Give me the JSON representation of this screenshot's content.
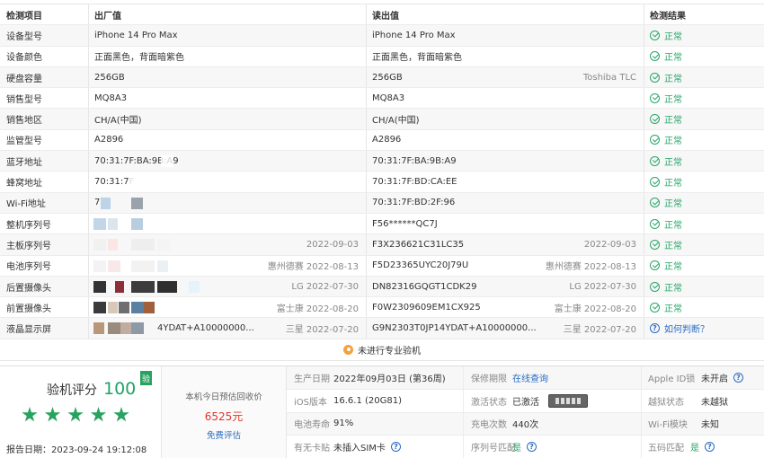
{
  "table": {
    "headers": {
      "item": "检测项目",
      "factory": "出厂值",
      "read": "读出值",
      "result": "检测结果"
    },
    "rows": [
      {
        "item": "设备型号",
        "factory": "iPhone 14 Pro Max",
        "factory_sub": "",
        "read": "iPhone 14 Pro Max",
        "read_sub": "",
        "result": "正常",
        "status": "ok"
      },
      {
        "item": "设备颜色",
        "factory": "正面黑色，背面暗紫色",
        "factory_sub": "",
        "read": "正面黑色，背面暗紫色",
        "read_sub": "",
        "result": "正常",
        "status": "ok"
      },
      {
        "item": "硬盘容量",
        "factory": "256GB",
        "factory_sub": "",
        "read": "256GB",
        "read_sub": "Toshiba TLC",
        "result": "正常",
        "status": "ok"
      },
      {
        "item": "销售型号",
        "factory": "MQ8A3",
        "factory_sub": "",
        "read": "MQ8A3",
        "read_sub": "",
        "result": "正常",
        "status": "ok"
      },
      {
        "item": "销售地区",
        "factory": "CH/A(中国)",
        "factory_sub": "",
        "read": "CH/A(中国)",
        "read_sub": "",
        "result": "正常",
        "status": "ok"
      },
      {
        "item": "监管型号",
        "factory": "A2896",
        "factory_sub": "",
        "read": "A2896",
        "read_sub": "",
        "result": "正常",
        "status": "ok"
      },
      {
        "item": "蓝牙地址",
        "factory": "70:31:7F:BA:9B:A9",
        "factory_sub": "",
        "read": "70:31:7F:BA:9B:A9",
        "read_sub": "",
        "result": "正常",
        "status": "ok"
      },
      {
        "item": "蜂窝地址",
        "factory": "70:31:7F",
        "factory_sub": "",
        "read": "70:31:7F:BD:CA:EE",
        "read_sub": "",
        "result": "正常",
        "status": "ok"
      },
      {
        "item": "Wi-Fi地址",
        "factory": "7",
        "factory_sub": "",
        "read": "70:31:7F:BD:2F:96",
        "read_sub": "",
        "result": "正常",
        "status": "ok"
      },
      {
        "item": "整机序列号",
        "factory": "",
        "factory_sub": "",
        "read": "F56******QC7J",
        "read_sub": "",
        "result": "正常",
        "status": "ok"
      },
      {
        "item": "主板序列号",
        "factory": "",
        "factory_sub": "2022-09-03",
        "read": "F3X236621C31LC35",
        "read_sub": "2022-09-03",
        "result": "正常",
        "status": "ok"
      },
      {
        "item": "电池序列号",
        "factory": "",
        "factory_sub": "惠州德赛 2022-08-13",
        "read": "F5D23365UYC20J79U",
        "read_sub": "惠州德赛 2022-08-13",
        "result": "正常",
        "status": "ok"
      },
      {
        "item": "后置摄像头",
        "factory": "",
        "factory_sub": "LG 2022-07-30",
        "read": "DN82316GQGT1CDK29",
        "read_sub": "LG 2022-07-30",
        "result": "正常",
        "status": "ok"
      },
      {
        "item": "前置摄像头",
        "factory": "",
        "factory_sub": "富士康 2022-08-20",
        "read": "F0W2309609EM1CX925",
        "read_sub": "富士康 2022-08-20",
        "result": "正常",
        "status": "ok"
      },
      {
        "item": "液晶显示屏",
        "factory": "4YDAT+A10000000...",
        "factory_sub": "三星 2022-07-20",
        "read": "G9N2303T0JP14YDAT+A10000000...",
        "read_sub": "三星 2022-07-20",
        "result": "如何判断？",
        "status": "query"
      }
    ],
    "footnote": "未进行专业验机"
  },
  "score": {
    "label": "验机评分",
    "value": "100",
    "tag": "验",
    "stars": 5,
    "report_date": "报告日期：2023-09-24 19:12:08"
  },
  "valuation": {
    "label": "本机今日预估回收价",
    "price": "6525元",
    "link": "免费评估"
  },
  "info": {
    "production_date_label": "生产日期",
    "production_date": "2022年09月03日 (第36周)",
    "warranty_label": "保修期限",
    "warranty": "在线查询",
    "apple_id_label": "Apple ID锁",
    "apple_id": "未开启",
    "ios_label": "iOS版本",
    "ios": "16.6.1 (20G81)",
    "activation_label": "激活状态",
    "activation": "已激活",
    "jailbreak_label": "越狱状态",
    "jailbreak": "未越狱",
    "battery_label": "电池寿命",
    "battery": "91%",
    "charge_label": "充电次数",
    "charge": "440次",
    "wifi_label": "Wi-Fi模块",
    "wifi": "未知",
    "sim_label": "有无卡贴",
    "sim": "未插入SIM卡",
    "serial_match_label": "序列号匹配",
    "serial_match": "是",
    "code_match_label": "五码匹配",
    "code_match": "是"
  },
  "colors": {
    "ok": "#2aa56a",
    "link": "#2a6cbf",
    "price": "#e0352b",
    "star": "#27a35f"
  }
}
